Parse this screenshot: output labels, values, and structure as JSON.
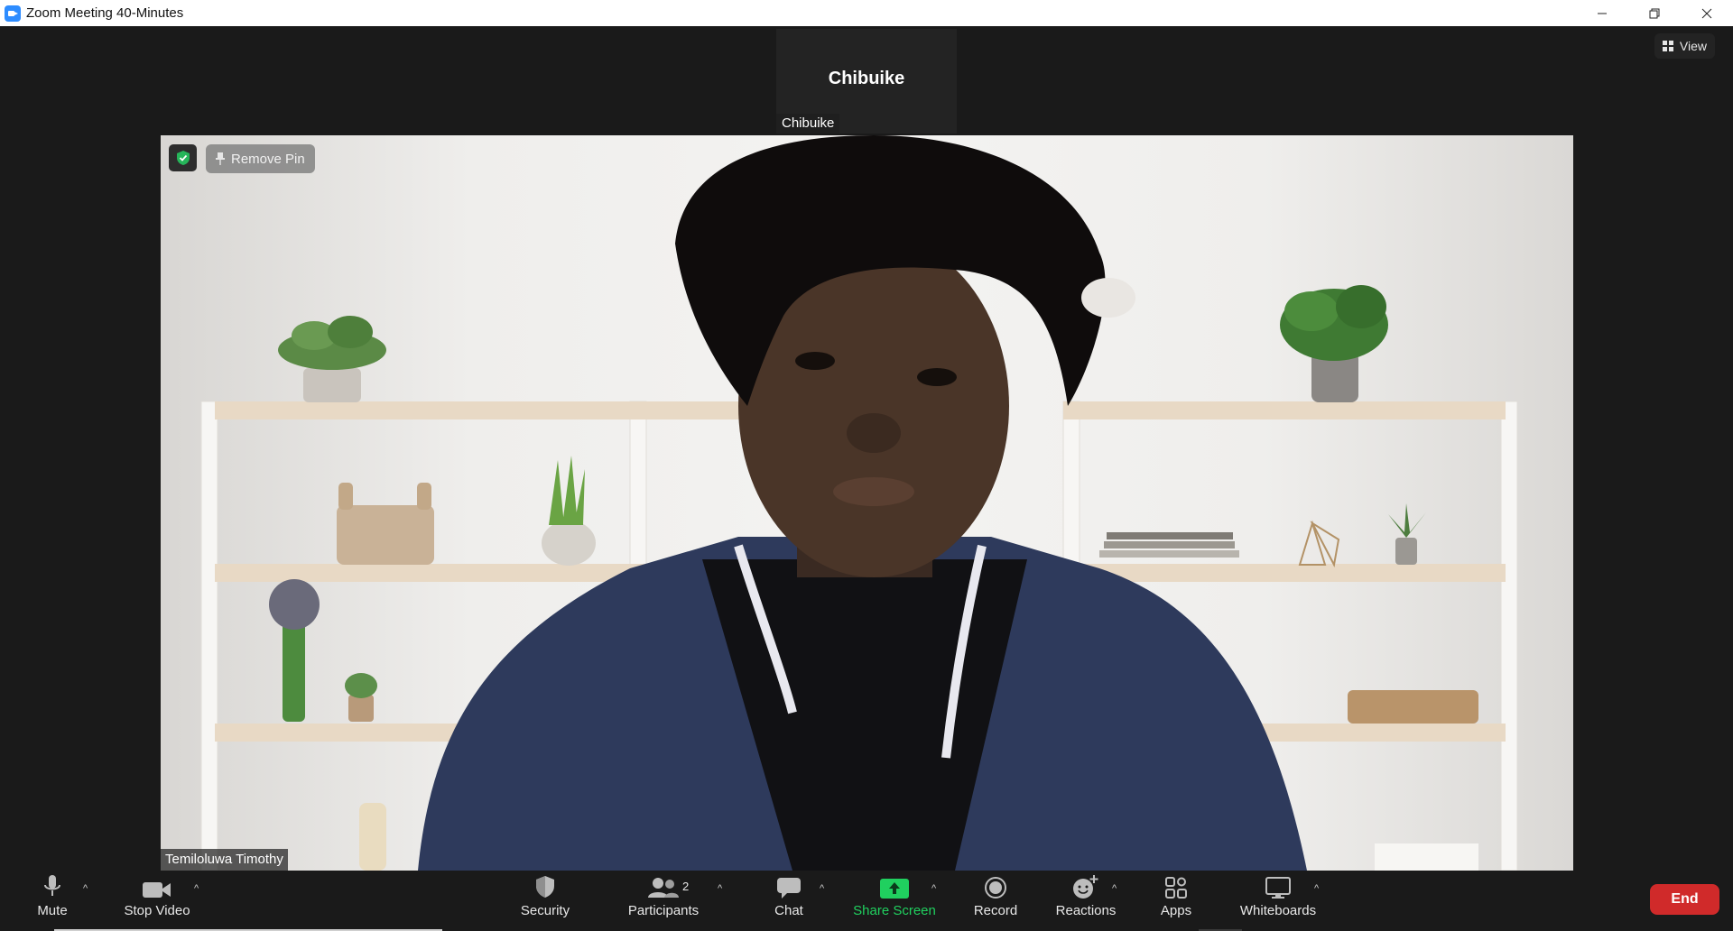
{
  "window": {
    "title": "Zoom Meeting 40-Minutes"
  },
  "view_button": {
    "label": "View"
  },
  "thumbnail": {
    "display_name": "Chibuike",
    "name_tag": "Chibuike"
  },
  "main_video": {
    "remove_pin_label": "Remove Pin",
    "name_tag": "Temiloluwa Timothy"
  },
  "toolbar": {
    "mute": "Mute",
    "stop_video": "Stop Video",
    "security": "Security",
    "participants": "Participants",
    "participants_count": "2",
    "chat": "Chat",
    "share_screen": "Share Screen",
    "record": "Record",
    "reactions": "Reactions",
    "apps": "Apps",
    "whiteboards": "Whiteboards",
    "end": "End"
  },
  "colors": {
    "background": "#1a1a1a",
    "share_green": "#20d05f",
    "end_red": "#d02a2a",
    "secure_green": "#26b55a"
  }
}
